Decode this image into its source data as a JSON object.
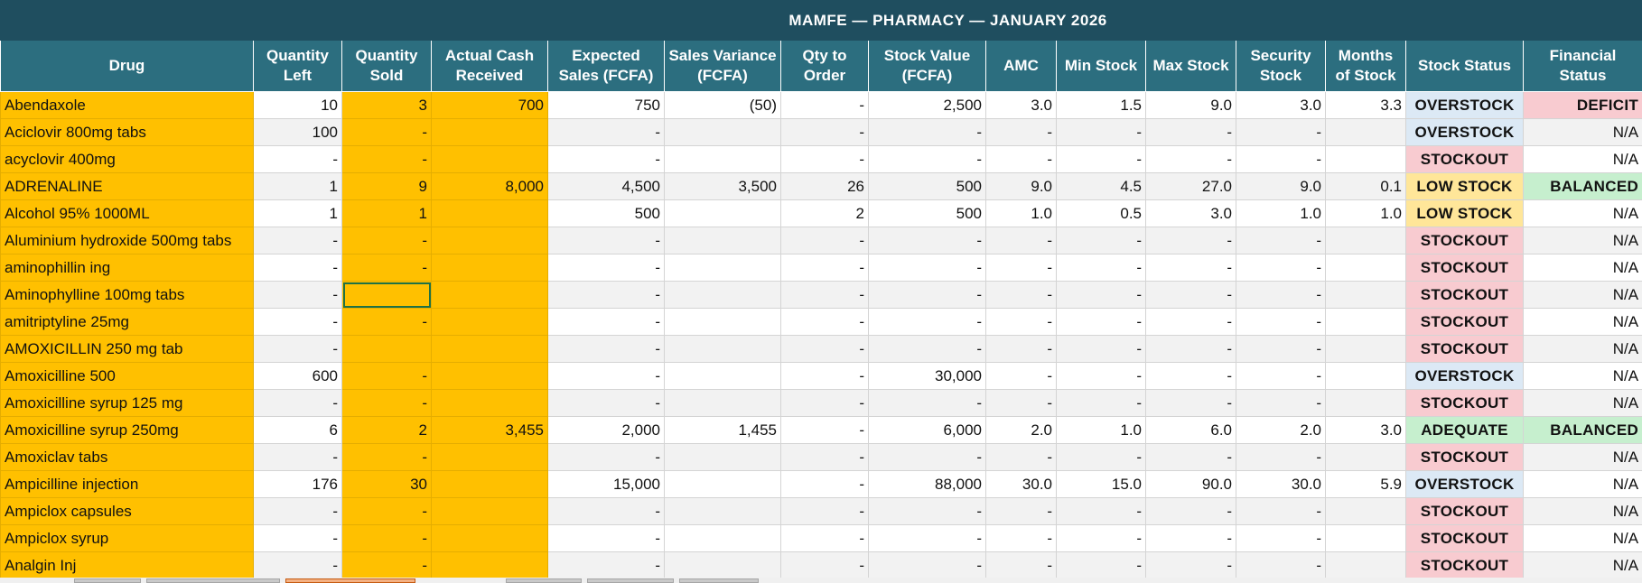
{
  "sheet": {
    "title": "MAMFE  —  PHARMACY  —  JANUARY 2026",
    "columns": [
      {
        "key": "drug",
        "label": "Drug"
      },
      {
        "key": "qty_left",
        "label": "Quantity Left"
      },
      {
        "key": "qty_sold",
        "label": "Quantity Sold"
      },
      {
        "key": "cash",
        "label": "Actual Cash Received"
      },
      {
        "key": "expected",
        "label": "Expected Sales (FCFA)"
      },
      {
        "key": "variance",
        "label": "Sales Variance (FCFA)"
      },
      {
        "key": "order",
        "label": "Qty to Order"
      },
      {
        "key": "stock_value",
        "label": "Stock Value (FCFA)"
      },
      {
        "key": "amc",
        "label": "AMC"
      },
      {
        "key": "min",
        "label": "Min Stock"
      },
      {
        "key": "max",
        "label": "Max Stock"
      },
      {
        "key": "security",
        "label": "Security Stock"
      },
      {
        "key": "months",
        "label": "Months of Stock"
      },
      {
        "key": "status",
        "label": "Stock Status"
      },
      {
        "key": "financial",
        "label": "Financial Status"
      }
    ],
    "status_colors": {
      "OVERSTOCK": "#1f4e79",
      "STOCKOUT": "#9c0006",
      "LOW STOCK": "#9c5700",
      "ADEQUATE": "#006100"
    },
    "selected_cell": {
      "row": 7,
      "column": "qty_sold"
    },
    "rows": [
      {
        "drug": "Abendaxole",
        "qty_left": "10",
        "qty_sold": "3",
        "cash": "700",
        "expected": "750",
        "variance": "(50)",
        "order": "-",
        "stock_value": "2,500",
        "amc": "3.0",
        "min": "1.5",
        "max": "9.0",
        "security": "3.0",
        "months": "3.3",
        "status": "OVERSTOCK",
        "financial": "DEFICIT"
      },
      {
        "drug": "Aciclovir 800mg tabs",
        "qty_left": "100",
        "qty_sold": "-",
        "cash": "",
        "expected": "-",
        "variance": "",
        "order": "-",
        "stock_value": "-",
        "amc": "-",
        "min": "-",
        "max": "-",
        "security": "-",
        "months": "",
        "status": "OVERSTOCK",
        "financial": "N/A"
      },
      {
        "drug": "acyclovir 400mg",
        "qty_left": "-",
        "qty_sold": "-",
        "cash": "",
        "expected": "-",
        "variance": "",
        "order": "-",
        "stock_value": "-",
        "amc": "-",
        "min": "-",
        "max": "-",
        "security": "-",
        "months": "",
        "status": "STOCKOUT",
        "financial": "N/A"
      },
      {
        "drug": "ADRENALINE",
        "qty_left": "1",
        "qty_sold": "9",
        "cash": "8,000",
        "expected": "4,500",
        "variance": "3,500",
        "order": "26",
        "stock_value": "500",
        "amc": "9.0",
        "min": "4.5",
        "max": "27.0",
        "security": "9.0",
        "months": "0.1",
        "status": "LOW STOCK",
        "financial": "BALANCED"
      },
      {
        "drug": "Alcohol 95% 1000ML",
        "qty_left": "1",
        "qty_sold": "1",
        "cash": "",
        "expected": "500",
        "variance": "",
        "order": "2",
        "stock_value": "500",
        "amc": "1.0",
        "min": "0.5",
        "max": "3.0",
        "security": "1.0",
        "months": "1.0",
        "status": "LOW STOCK",
        "financial": "N/A"
      },
      {
        "drug": "Aluminium hydroxide 500mg tabs",
        "qty_left": "-",
        "qty_sold": "-",
        "cash": "",
        "expected": "-",
        "variance": "",
        "order": "-",
        "stock_value": "-",
        "amc": "-",
        "min": "-",
        "max": "-",
        "security": "-",
        "months": "",
        "status": "STOCKOUT",
        "financial": "N/A"
      },
      {
        "drug": "aminophillin ing",
        "qty_left": "-",
        "qty_sold": "-",
        "cash": "",
        "expected": "-",
        "variance": "",
        "order": "-",
        "stock_value": "-",
        "amc": "-",
        "min": "-",
        "max": "-",
        "security": "-",
        "months": "",
        "status": "STOCKOUT",
        "financial": "N/A"
      },
      {
        "drug": "Aminophylline 100mg tabs",
        "qty_left": "-",
        "qty_sold": "",
        "cash": "",
        "expected": "-",
        "variance": "",
        "order": "-",
        "stock_value": "-",
        "amc": "-",
        "min": "-",
        "max": "-",
        "security": "-",
        "months": "",
        "status": "STOCKOUT",
        "financial": "N/A"
      },
      {
        "drug": "amitriptyline 25mg",
        "qty_left": "-",
        "qty_sold": "-",
        "cash": "",
        "expected": "-",
        "variance": "",
        "order": "-",
        "stock_value": "-",
        "amc": "-",
        "min": "-",
        "max": "-",
        "security": "-",
        "months": "",
        "status": "STOCKOUT",
        "financial": "N/A"
      },
      {
        "drug": "AMOXICILLIN 250 mg tab",
        "qty_left": "-",
        "qty_sold": "",
        "cash": "",
        "expected": "-",
        "variance": "",
        "order": "-",
        "stock_value": "-",
        "amc": "-",
        "min": "-",
        "max": "-",
        "security": "-",
        "months": "",
        "status": "STOCKOUT",
        "financial": "N/A"
      },
      {
        "drug": "Amoxicilline 500",
        "qty_left": "600",
        "qty_sold": "-",
        "cash": "",
        "expected": "-",
        "variance": "",
        "order": "-",
        "stock_value": "30,000",
        "amc": "-",
        "min": "-",
        "max": "-",
        "security": "-",
        "months": "",
        "status": "OVERSTOCK",
        "financial": "N/A"
      },
      {
        "drug": "Amoxicilline syrup 125 mg",
        "qty_left": "-",
        "qty_sold": "-",
        "cash": "",
        "expected": "-",
        "variance": "",
        "order": "-",
        "stock_value": "-",
        "amc": "-",
        "min": "-",
        "max": "-",
        "security": "-",
        "months": "",
        "status": "STOCKOUT",
        "financial": "N/A"
      },
      {
        "drug": "Amoxicilline syrup 250mg",
        "qty_left": "6",
        "qty_sold": "2",
        "cash": "3,455",
        "expected": "2,000",
        "variance": "1,455",
        "order": "-",
        "stock_value": "6,000",
        "amc": "2.0",
        "min": "1.0",
        "max": "6.0",
        "security": "2.0",
        "months": "3.0",
        "status": "ADEQUATE",
        "financial": "BALANCED"
      },
      {
        "drug": "Amoxiclav tabs",
        "qty_left": "-",
        "qty_sold": "-",
        "cash": "",
        "expected": "-",
        "variance": "",
        "order": "-",
        "stock_value": "-",
        "amc": "-",
        "min": "-",
        "max": "-",
        "security": "-",
        "months": "",
        "status": "STOCKOUT",
        "financial": "N/A"
      },
      {
        "drug": "Ampicilline injection",
        "qty_left": "176",
        "qty_sold": "30",
        "cash": "",
        "expected": "15,000",
        "variance": "",
        "order": "-",
        "stock_value": "88,000",
        "amc": "30.0",
        "min": "15.0",
        "max": "90.0",
        "security": "30.0",
        "months": "5.9",
        "status": "OVERSTOCK",
        "financial": "N/A"
      },
      {
        "drug": "Ampiclox capsules",
        "qty_left": "-",
        "qty_sold": "-",
        "cash": "",
        "expected": "-",
        "variance": "",
        "order": "-",
        "stock_value": "-",
        "amc": "-",
        "min": "-",
        "max": "-",
        "security": "-",
        "months": "",
        "status": "STOCKOUT",
        "financial": "N/A"
      },
      {
        "drug": "Ampiclox syrup",
        "qty_left": "-",
        "qty_sold": "-",
        "cash": "",
        "expected": "-",
        "variance": "",
        "order": "-",
        "stock_value": "-",
        "amc": "-",
        "min": "-",
        "max": "-",
        "security": "-",
        "months": "",
        "status": "STOCKOUT",
        "financial": "N/A"
      },
      {
        "drug": "Analgin Inj",
        "qty_left": "-",
        "qty_sold": "-",
        "cash": "",
        "expected": "-",
        "variance": "",
        "order": "-",
        "stock_value": "-",
        "amc": "-",
        "min": "-",
        "max": "-",
        "security": "-",
        "months": "",
        "status": "STOCKOUT",
        "financial": "N/A"
      }
    ]
  }
}
